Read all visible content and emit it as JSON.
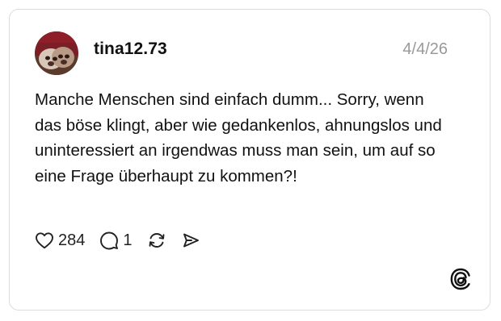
{
  "post": {
    "username": "tina12.73",
    "date": "4/4/26",
    "text": "Manche Menschen sind einfach dumm... Sorry, wenn das böse klingt, aber wie gedankenlos, ahnungslos und uninteressiert an irgendwas muss man sein, um auf so eine Frage überhaupt zu kommen?!"
  },
  "actions": {
    "like_icon": "heart-icon",
    "like_count": "284",
    "reply_icon": "comment-icon",
    "reply_count": "1",
    "repost_icon": "repost-icon",
    "share_icon": "send-icon"
  },
  "branding": {
    "logo_icon": "threads-logo-icon"
  },
  "colors": {
    "text": "#111111",
    "muted": "#999999",
    "border": "#dcdcdc"
  }
}
